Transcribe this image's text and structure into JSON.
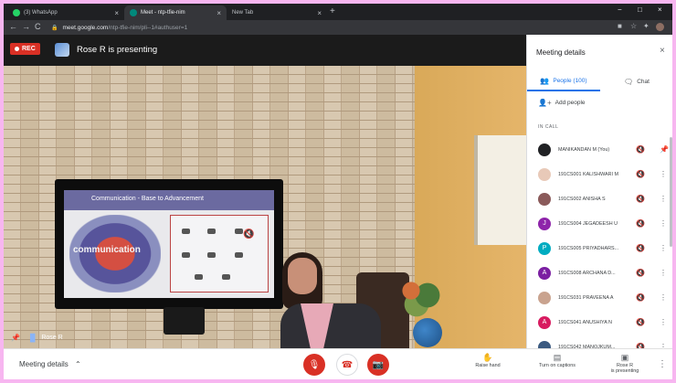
{
  "browser": {
    "tabs": [
      {
        "label": "(3) WhatsApp",
        "close": "×"
      },
      {
        "label": "Meet - ntp-tfie-nim",
        "close": "×"
      },
      {
        "label": "New Tab",
        "close": "×"
      }
    ],
    "new_tab": "+",
    "window_controls": [
      "−",
      "□",
      "×"
    ],
    "nav": [
      "←",
      "→",
      "C"
    ],
    "url_host": "meet.google.com",
    "url_path": "/ntp-tfie-nim/pli--1#authuser=1"
  },
  "meet": {
    "rec_label": "REC",
    "presenting_text": "Rose R is presenting",
    "slide_title": "Communication - Base to Advancement",
    "slide_word": "communication",
    "tile_name": "Rose R"
  },
  "panel": {
    "title": "Meeting details",
    "close": "×",
    "tabs": [
      {
        "label": "People (100)",
        "icon": "people-icon"
      },
      {
        "label": "Chat",
        "icon": "chat-icon"
      }
    ],
    "add_people": "Add people",
    "section_label": "IN CALL",
    "participants": [
      {
        "name": "MANIKANDAN M (You)",
        "avatar_color": "#202124",
        "initial": ""
      },
      {
        "name": "191CS001 KALISHWARI M",
        "avatar_color": "#e8c9b8",
        "initial": ""
      },
      {
        "name": "191CS002 ANISHA S",
        "avatar_color": "#8a5a5a",
        "initial": ""
      },
      {
        "name": "191CS004 JEGADEESH U",
        "avatar_color": "#8e24aa",
        "initial": "J"
      },
      {
        "name": "191CS005 PRIYADHARS...",
        "avatar_color": "#00acc1",
        "initial": "P"
      },
      {
        "name": "191CS008 ARCHANA D...",
        "avatar_color": "#7b1fa2",
        "initial": "A"
      },
      {
        "name": "191CS031 PRAVEENA A",
        "avatar_color": "#c9a38f",
        "initial": ""
      },
      {
        "name": "191CS041 ANUSHIYA N",
        "avatar_color": "#d81b60",
        "initial": "A"
      },
      {
        "name": "191CS042 MANOJKUM...",
        "avatar_color": "#3b5a80",
        "initial": ""
      }
    ]
  },
  "bottom": {
    "meeting_details": "Meeting details",
    "raise_hand": "Raise hand",
    "captions": "Turn on captions",
    "presenting_line1": "Rose R",
    "presenting_line2": "is presenting"
  },
  "colors": {
    "meet_red": "#d93025",
    "accent_blue": "#1a73e8",
    "page_border": "#f7b6f0"
  }
}
